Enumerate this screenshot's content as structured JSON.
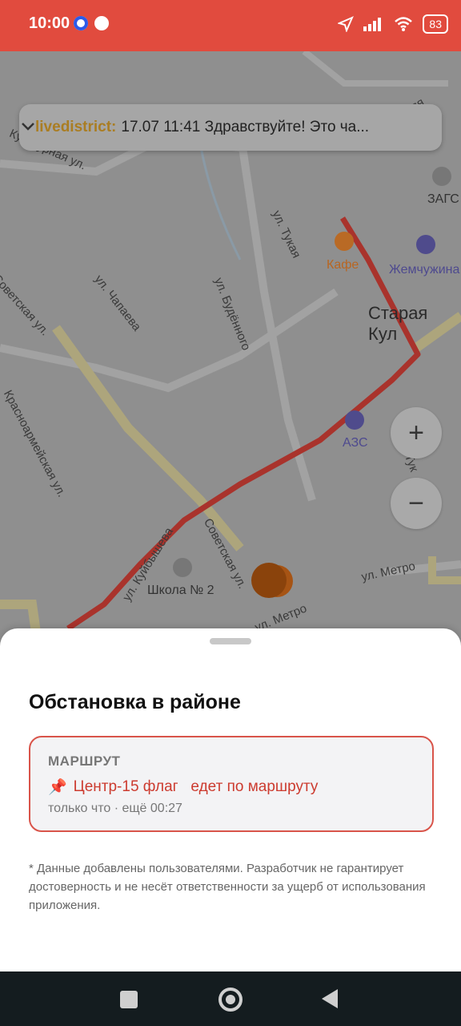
{
  "status_bar": {
    "time": "10:00",
    "battery": "83"
  },
  "notification": {
    "user": "livedistrict:",
    "message": "17.07 11:41 Здравствуйте! Это ча..."
  },
  "map": {
    "labels": {
      "kulturnaya": "Культурная ул.",
      "sovetskaya1": "Советская ул.",
      "chapaeva": "ул. Чапаева",
      "tukaya": "ул. Тукая",
      "budennogo": "ул. Будённого",
      "krasnoarmeyskaya": "Красноармейская ул.",
      "kuybysheva": "ул. Куйбышева",
      "sovetskaya2": "Советская ул.",
      "metro1": "ул. Метро",
      "metro2": "ул. Метро",
      "staraya": "Старая Кул",
      "nizhnyaya": "Нижняя",
      "tuk": "Тук"
    },
    "pois": {
      "kafe": "Кафе",
      "zhemchuzhina": "Жемчужина",
      "zags": "ЗАГС",
      "azs": "АЗС",
      "shkola": "Школа № 2"
    },
    "zoom_in": "+",
    "zoom_out": "−"
  },
  "sheet": {
    "title": "Обстановка в районе",
    "card": {
      "type": "МАРШРУТ",
      "pin": "📌",
      "text": "Центр-15 флаг   едет по маршруту",
      "meta": "только что · ещё 00:27"
    },
    "disclaimer": "* Данные добавлены пользователями. Разработчик не гарантирует достоверность и не несёт ответственности за ущерб от использования приложения."
  },
  "colors": {
    "status_bg": "#e14b3e",
    "route": "#a9332c",
    "card_border": "#d9544a"
  }
}
